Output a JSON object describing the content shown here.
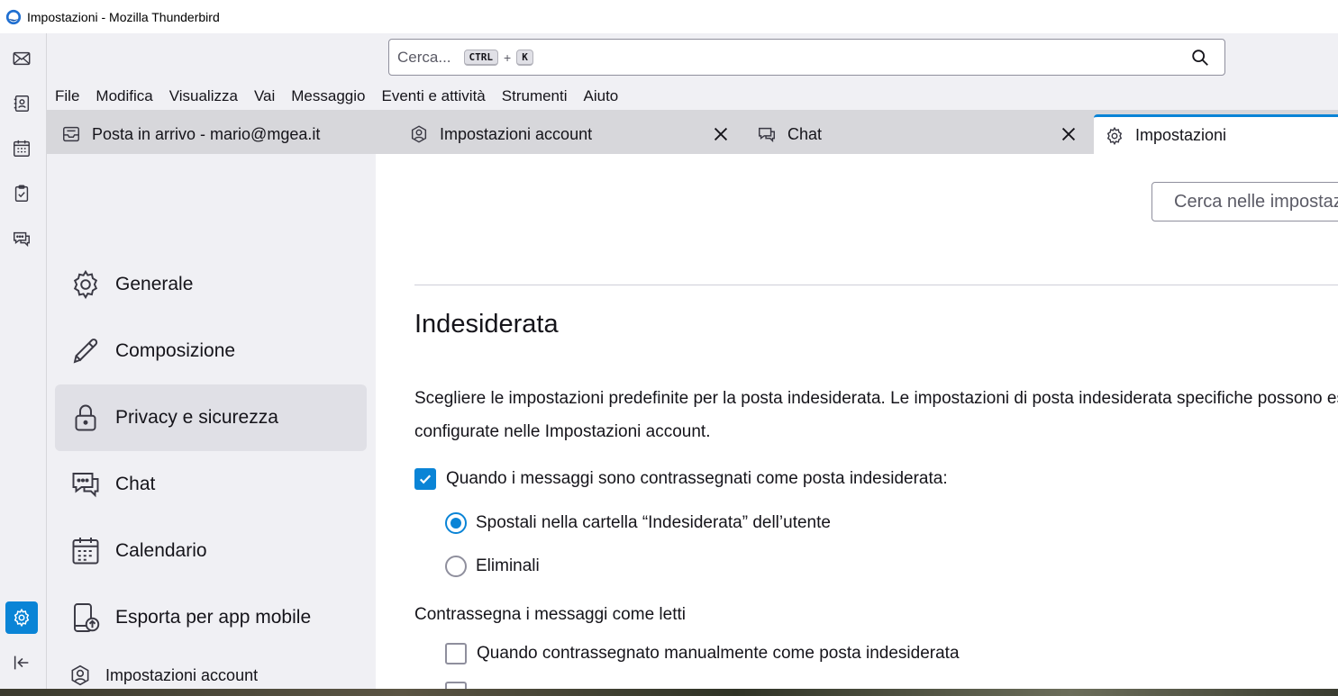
{
  "window": {
    "title": "Impostazioni - Mozilla Thunderbird"
  },
  "spaces": [
    {
      "name": "mail-icon"
    },
    {
      "name": "address-book-icon"
    },
    {
      "name": "calendar-icon"
    },
    {
      "name": "tasks-icon"
    },
    {
      "name": "chat-icon"
    },
    {
      "name": "settings-icon",
      "active": true
    },
    {
      "name": "collapse-icon"
    }
  ],
  "search": {
    "placeholder": "Cerca...",
    "key1": "CTRL",
    "plus": "+",
    "key2": "K"
  },
  "menu": {
    "file": "File",
    "edit": "Modifica",
    "view": "Visualizza",
    "go": "Vai",
    "message": "Messaggio",
    "events": "Eventi e attività",
    "tools": "Strumenti",
    "help": "Aiuto"
  },
  "tabs": [
    {
      "label": "Posta in arrivo - mario@mgea.it"
    },
    {
      "label": "Impostazioni account"
    },
    {
      "label": "Chat"
    },
    {
      "label": "Impostazioni"
    }
  ],
  "sidebar": {
    "categories": [
      {
        "label": "Generale"
      },
      {
        "label": "Composizione"
      },
      {
        "label": "Privacy e sicurezza",
        "selected": true
      },
      {
        "label": "Chat"
      },
      {
        "label": "Calendario"
      },
      {
        "label": "Esporta per app mobile"
      }
    ],
    "account_settings": "Impostazioni account"
  },
  "content": {
    "search_placeholder": "Cerca nelle impostazioni",
    "section_title": "Indesiderata",
    "description_line1": "Scegliere le impostazioni predefinite per la posta indesiderata. Le impostazioni di posta indesiderata specifiche possono essere",
    "description_line2": "configurate nelle Impostazioni account.",
    "when_marked_label": "Quando i messaggi sono contrassegnati come posta indesiderata:",
    "when_marked_checked": true,
    "move_option": "Spostali nella cartella “Indesiderata” dell’utente",
    "move_selected": true,
    "delete_option": "Eliminali",
    "mark_read_label": "Contrassegna i messaggi come letti",
    "manual_mark_label": "Quando contrassegnato manualmente come posta indesiderata",
    "manual_mark_checked": false
  },
  "colors": {
    "accent": "#0a84d6",
    "sidebar_bg": "#f0f0f4",
    "tabstrip_bg": "#d7d7db"
  }
}
